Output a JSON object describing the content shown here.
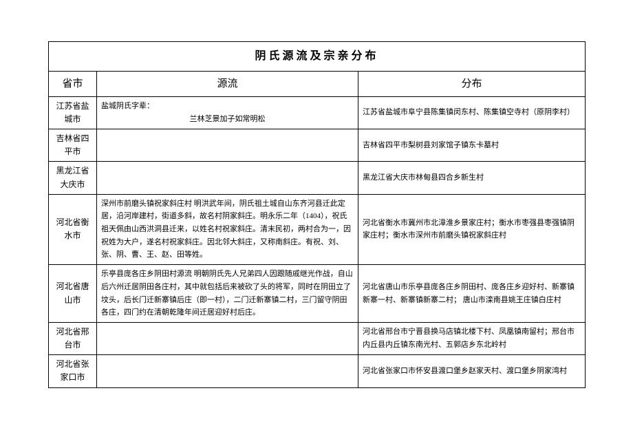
{
  "title": "阴氏源流及宗亲分布",
  "headers": {
    "province": "省市",
    "source": "源流",
    "distribution": "分布"
  },
  "rows": [
    {
      "province": "江苏省盐城市",
      "source_line1": "盐城阴氏字辈：",
      "source_line2": "兰林芝景加子如常明松",
      "distribution": "江苏省盐城市阜宁县陈集镇闵东村、陈集镇空寺村（原阴李村）"
    },
    {
      "province": "吉林省四平市",
      "source": "",
      "distribution": "吉林省四平市梨树县刘家馆子镇东卡墓村"
    },
    {
      "province": "黑龙江省大庆市",
      "source": "",
      "distribution": "黑龙江省大庆市林甸县四合乡新生村"
    },
    {
      "province": "河北省衡水市",
      "source": "深州市前磨头镇祝家斜庄村\n明洪武年间，阴氏祖土城自山东齐河县迁此定居，沿河岸建村，街道多斜，故名村阴家斜庄。明永乐二年（1404），祝氏祖天佩由山西洪洞县迁来，以姓名村祝家斜庄。清末民初，两村合为一，因祝姓为大户，遂名村祝家斜庄。因北邻大斜庄，又称南斜庄。有祝、刘、张、阴、曹、王、赵、田等姓。",
      "distribution": "河北省衡水市冀州市北漳淮乡景家庄村；衡水市枣强县枣强镇阴家庄村；衡水市深州市前磨头镇祝家斜庄村"
    },
    {
      "province": "河北省唐山市",
      "source": "乐亭县庞各庄乡阴田村源流\n明朝阴氏先人兄弟四人因跟随戚继光作战，自山后六州迁居阴田各庄村，其中就包括后来被砍了头的将军，同时在阴田立了坟头，后长门迁新寨镇后庄（即一村），二门迁新寨镇二村，三门留守阴田各庄，四门约在清朝乾隆年间迁居迎好村后庄。",
      "distribution": "河北省唐山市乐亭县庞各庄乡阴田村、庞各庄乡迎好村、新寨镇新寨一村、新寨镇新寨二村；\n唐山市滦南县姚王庄镇白庄村"
    },
    {
      "province": "河北省邢台市",
      "source": "",
      "distribution": "河北省邢台市宁晋县换马店镇北楼下村、凤凰镇南留村；邢台市内丘县内丘镇东南光村、五郭店乡东北岭村"
    },
    {
      "province": "河北省张家口市",
      "source": "",
      "distribution": "河北省张家口市怀安县渡口堡乡赵家天村、渡口堡乡阴家湾村"
    }
  ]
}
